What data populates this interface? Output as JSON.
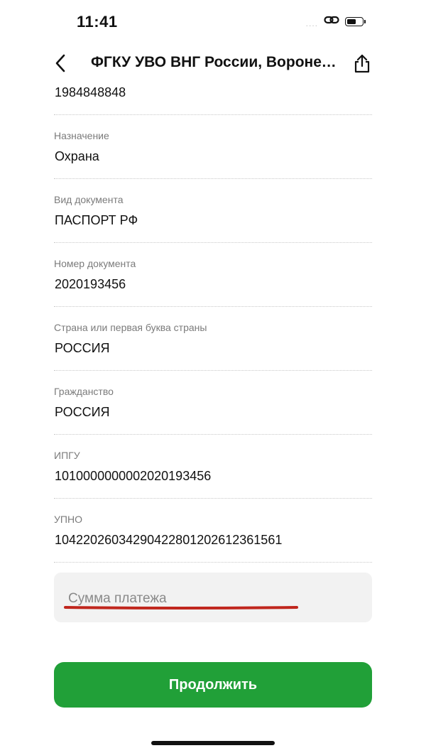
{
  "status_bar": {
    "time": "11:41",
    "signal": "....",
    "battery_level": 0.6
  },
  "nav": {
    "title": "ФГКУ УВО ВНГ России, Воронежская область"
  },
  "fields": [
    {
      "label": "",
      "value": "1984848848"
    },
    {
      "label": "Назначение",
      "value": "Охрана"
    },
    {
      "label": "Вид документа",
      "value": "ПАСПОРТ РФ"
    },
    {
      "label": "Номер документа",
      "value": "2020193456"
    },
    {
      "label": "Страна или первая буква страны",
      "value": "РОССИЯ"
    },
    {
      "label": "Гражданство",
      "value": "РОССИЯ"
    },
    {
      "label": "ИПГУ",
      "value": "1010000000002020193456"
    },
    {
      "label": "УПНО",
      "value": "10422026034290422801202612361561"
    }
  ],
  "amount_input": {
    "placeholder": "Сумма платежа",
    "value": ""
  },
  "continue_button": {
    "label": "Продолжить"
  },
  "colors": {
    "accent_green": "#21A038",
    "error_underline": "#C0261D",
    "input_background": "#F2F2F2"
  },
  "icons": {
    "back": "chevron-left-icon",
    "share": "share-icon",
    "link": "link-icon",
    "battery": "battery-icon"
  }
}
